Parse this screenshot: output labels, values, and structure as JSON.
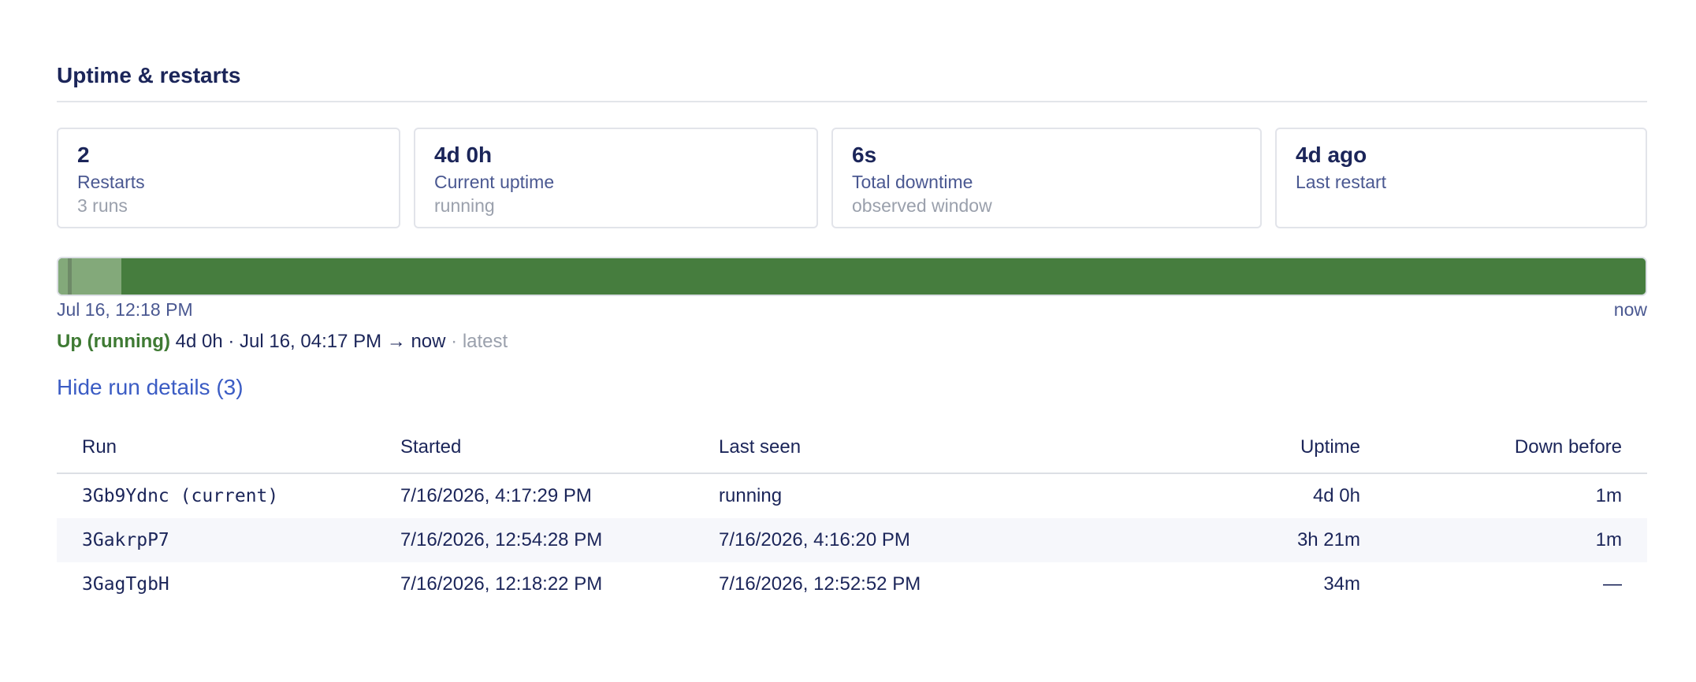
{
  "section": {
    "title": "Uptime & restarts"
  },
  "cards": [
    {
      "value": "2",
      "label": "Restarts",
      "sub": "3 runs"
    },
    {
      "value": "4d 0h",
      "label": "Current uptime",
      "sub": "running"
    },
    {
      "value": "6s",
      "label": "Total downtime",
      "sub": "observed window"
    },
    {
      "value": "4d ago",
      "label": "Last restart",
      "sub": ""
    }
  ],
  "timeline": {
    "start_label": "Jul 16, 12:18 PM",
    "end_label": "now",
    "colors": {
      "up_current": "#467d3e",
      "up_past": "#83a97a",
      "down": "#6e8a68"
    }
  },
  "status": {
    "state": "Up (running)",
    "detail": "4d 0h · Jul 16, 04:17 PM → now",
    "tag": "· latest"
  },
  "runs_toggle": {
    "label": "Hide run details (3)"
  },
  "runs_table": {
    "headers": {
      "run": "Run",
      "started": "Started",
      "last_seen": "Last seen",
      "uptime": "Uptime",
      "down_before": "Down before"
    },
    "rows": [
      {
        "run": "3Gb9Ydnc (current)",
        "started": "7/16/2026, 4:17:29 PM",
        "last_seen": "running",
        "uptime": "4d 0h",
        "down_before": "1m"
      },
      {
        "run": "3GakrpP7",
        "started": "7/16/2026, 12:54:28 PM",
        "last_seen": "7/16/2026, 4:16:20 PM",
        "uptime": "3h 21m",
        "down_before": "1m"
      },
      {
        "run": "3GagTgbH",
        "started": "7/16/2026, 12:18:22 PM",
        "last_seen": "7/16/2026, 12:52:52 PM",
        "uptime": "34m",
        "down_before": "—"
      }
    ]
  },
  "accent_colors": {
    "title": "#1b2559",
    "link": "#3b5cc4",
    "up_state": "#3e7a33"
  }
}
